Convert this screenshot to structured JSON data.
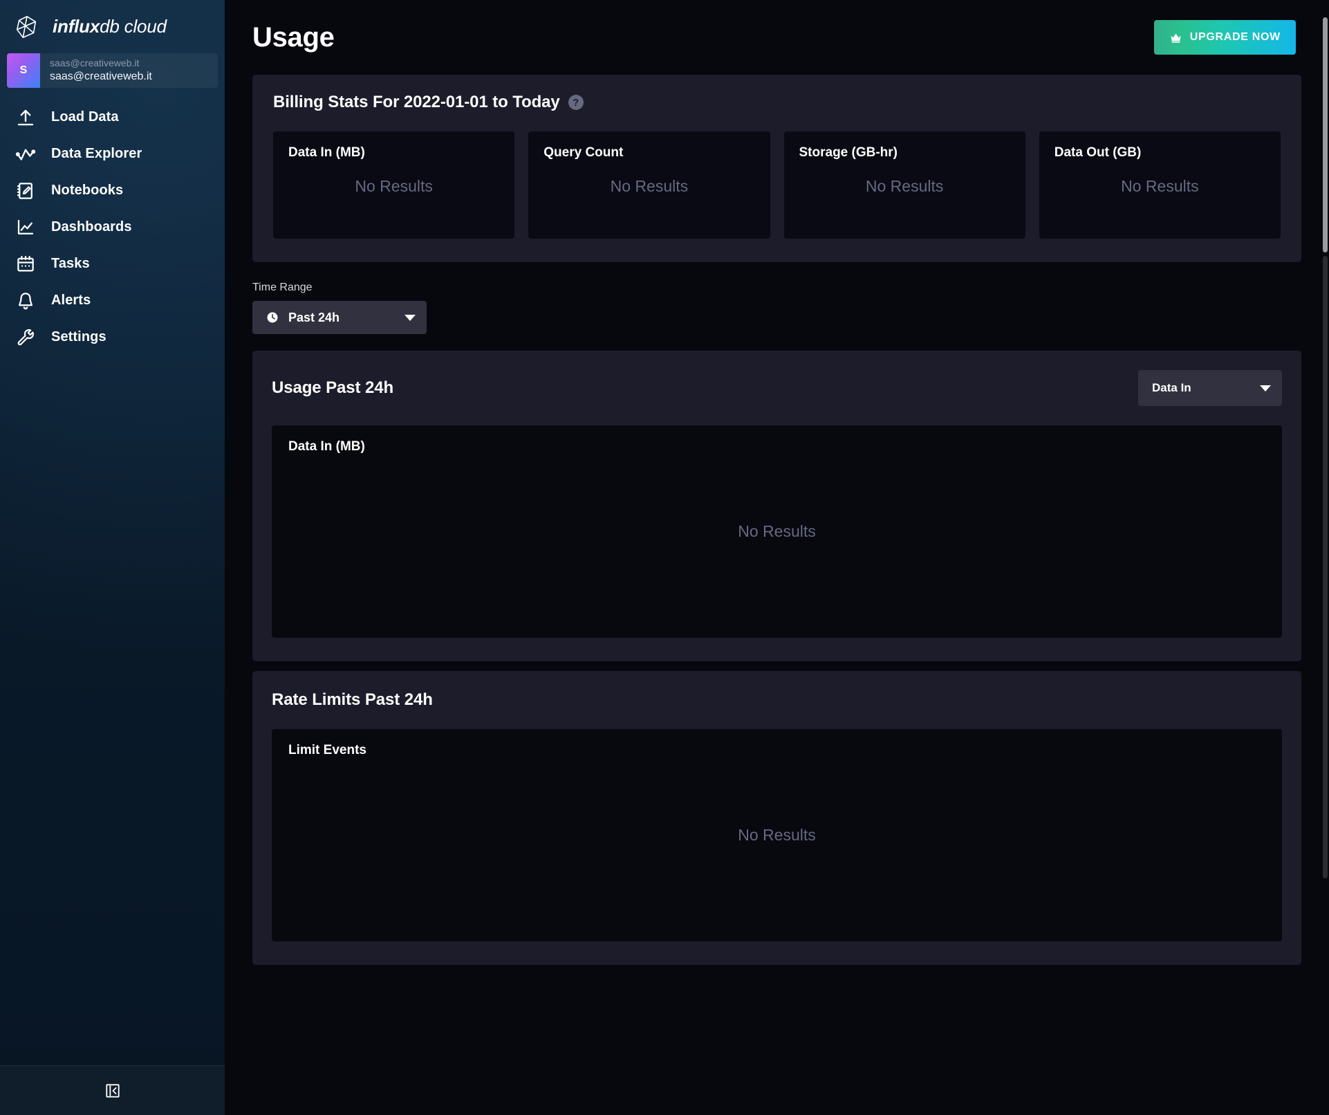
{
  "brand": {
    "name_bold": "influx",
    "name_rest": "db cloud",
    "logo_icon": "influxdb-polyhedron-logo"
  },
  "sidebar": {
    "account": {
      "avatar_initial": "S",
      "org": "saas@creativeweb.it",
      "user": "saas@creativeweb.it"
    },
    "items": [
      {
        "label": "Load Data",
        "icon": "upload-icon"
      },
      {
        "label": "Data Explorer",
        "icon": "data-explorer-icon"
      },
      {
        "label": "Notebooks",
        "icon": "notebook-pencil-icon"
      },
      {
        "label": "Dashboards",
        "icon": "line-chart-icon"
      },
      {
        "label": "Tasks",
        "icon": "calendar-icon"
      },
      {
        "label": "Alerts",
        "icon": "bell-icon"
      },
      {
        "label": "Settings",
        "icon": "wrench-icon"
      }
    ],
    "collapse_icon": "collapse-left-icon"
  },
  "header": {
    "title": "Usage",
    "upgrade_label": "UPGRADE NOW",
    "upgrade_icon": "crown-icon",
    "upgrade_gradient_from": "#32b08c",
    "upgrade_gradient_to": "#14b7e8"
  },
  "billing": {
    "title": "Billing Stats For 2022-01-01 to Today",
    "help_icon": "question-mark-icon",
    "help_glyph": "?",
    "cards": [
      {
        "label": "Data In (MB)",
        "value": "No Results"
      },
      {
        "label": "Query Count",
        "value": "No Results"
      },
      {
        "label": "Storage (GB-hr)",
        "value": "No Results"
      },
      {
        "label": "Data Out (GB)",
        "value": "No Results"
      }
    ]
  },
  "time_range": {
    "label": "Time Range",
    "selected": "Past 24h",
    "icon": "clock-icon",
    "caret_icon": "chevron-down-icon"
  },
  "usage": {
    "title": "Usage Past 24h",
    "metric_selected": "Data In",
    "metric_caret_icon": "chevron-down-icon",
    "graph": {
      "title": "Data In (MB)",
      "empty_text": "No Results"
    }
  },
  "rate_limits": {
    "title": "Rate Limits Past 24h",
    "graph": {
      "title": "Limit Events",
      "empty_text": "No Results"
    }
  },
  "scrollbar": {
    "orientation": "vertical"
  }
}
